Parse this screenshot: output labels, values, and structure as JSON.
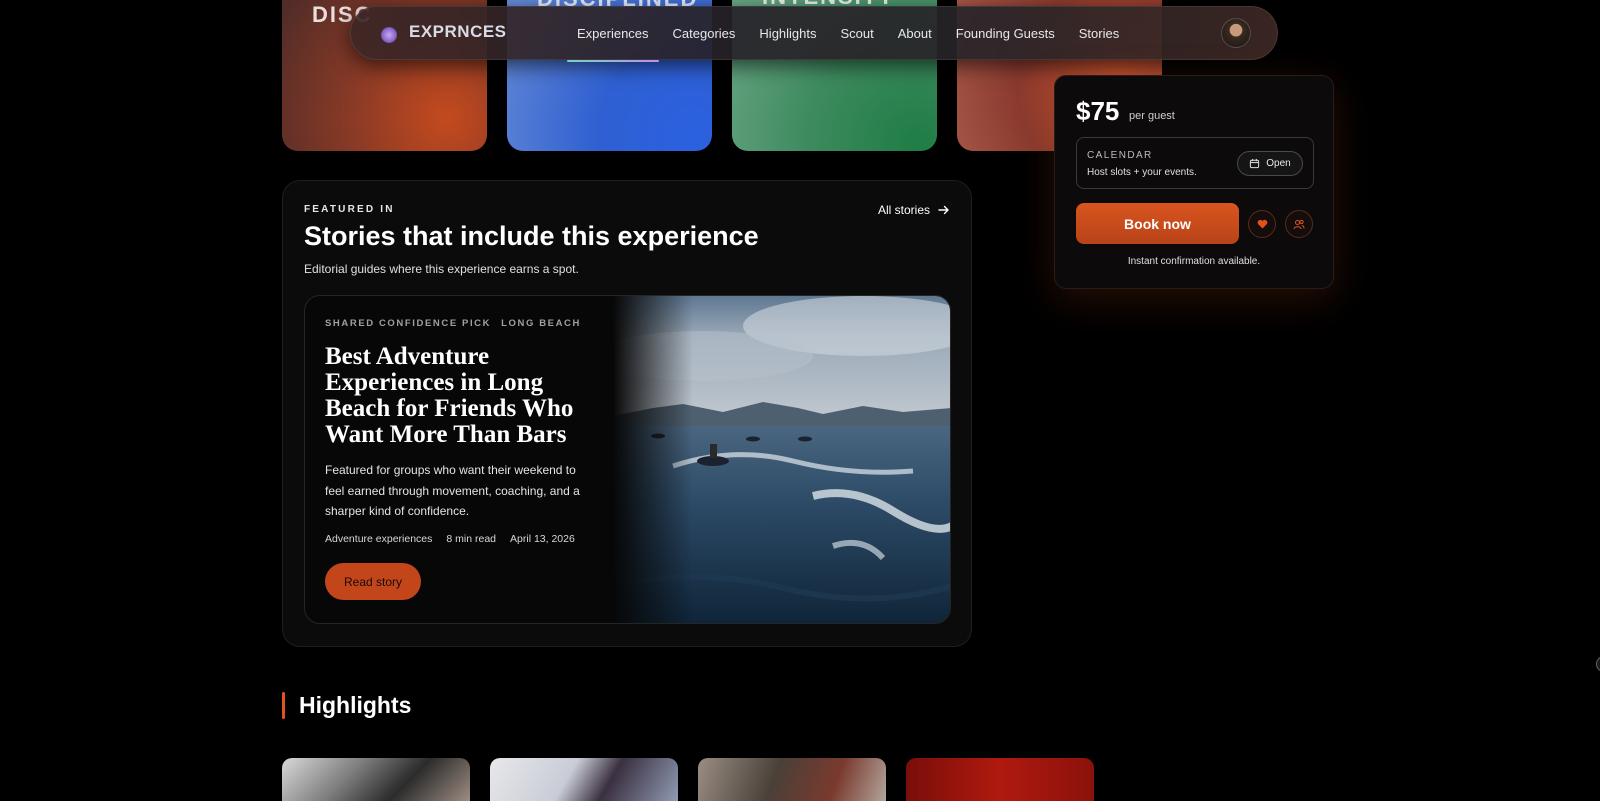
{
  "tiles": [
    {
      "text": "DISC"
    },
    {
      "text": "DISCIPLINED"
    },
    {
      "text": "INTENSITY"
    },
    {
      "text": ""
    }
  ],
  "nav": {
    "logo": "EXPRNCES",
    "links": [
      "Experiences",
      "Categories",
      "Highlights",
      "Scout",
      "About",
      "Founding Guests",
      "Stories"
    ],
    "active": "Experiences"
  },
  "booking": {
    "price": "$75",
    "per_guest": "per guest",
    "calendar_label": "CALENDAR",
    "calendar_sub": "Host slots + your events.",
    "open_label": "Open",
    "book_label": "Book now",
    "instant": "Instant confirmation available.",
    "accent": "#d9551e"
  },
  "featured": {
    "kicker": "FEATURED IN",
    "title": "Stories that include this experience",
    "subtitle": "Editorial guides where this experience earns a spot.",
    "all_stories": "All stories",
    "story": {
      "tags": [
        "SHARED CONFIDENCE PICK",
        "LONG BEACH"
      ],
      "title": "Best Adventure Experiences in Long Beach for Friends Who Want More Than Bars",
      "description": "Featured for groups who want their weekend to feel earned through movement, coaching, and a sharper kind of confidence.",
      "meta": [
        "Adventure experiences",
        "8 min read",
        "April 13, 2026"
      ],
      "cta": "Read story"
    }
  },
  "highlights": {
    "title": "Highlights"
  }
}
